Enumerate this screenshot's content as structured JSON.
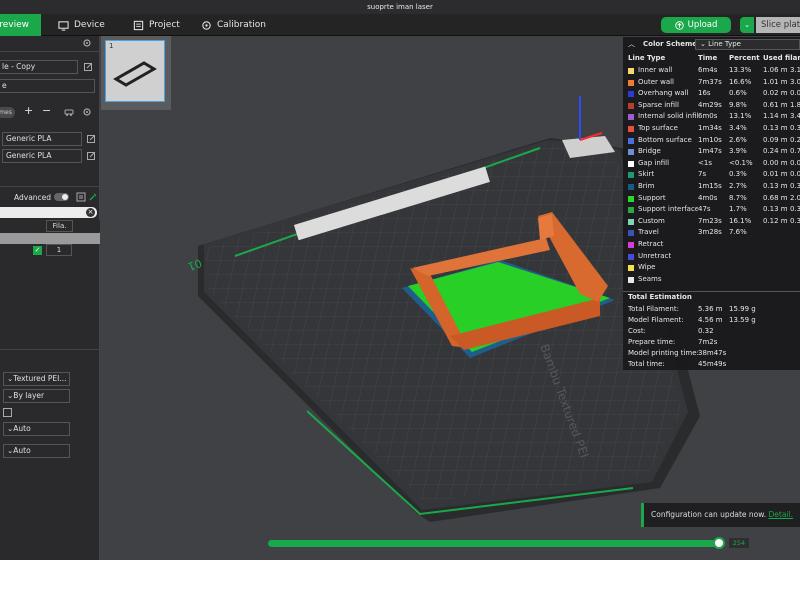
{
  "title": "suoprte iman laser",
  "topbar": {
    "tabs": [
      {
        "label": "review"
      },
      {
        "label": "Device"
      },
      {
        "label": "Project"
      },
      {
        "label": "Calibration"
      }
    ],
    "upload_label": "Upload",
    "slice_label": "Slice plate"
  },
  "sidebar": {
    "profile_value": "le - Copy",
    "profile2_value": "e",
    "items_chip": "mes",
    "filaments": [
      "Generic PLA",
      "Generic PLA"
    ],
    "advanced_label": "Advanced",
    "table_header": "Fila.",
    "table_value": "1",
    "plate_type": "Textured PEI...",
    "layer_mode": "By layer",
    "auto1": "Auto",
    "auto2": "Auto"
  },
  "plate": {
    "number": "1",
    "bed_label": "Bambu Textured PEI",
    "bed_number": "01"
  },
  "legend": {
    "scheme_label": "Color Scheme",
    "scheme_value": "Line Type",
    "headers": [
      "Line Type",
      "Time",
      "Percent",
      "Used filament"
    ],
    "rows": [
      {
        "name": "Inner wall",
        "time": "6m4s",
        "percent": "13.3%",
        "len": "1.06 m",
        "g": "3.1",
        "color": "#f5d76e"
      },
      {
        "name": "Outer wall",
        "time": "7m37s",
        "percent": "16.6%",
        "len": "1.01 m",
        "g": "3.0",
        "color": "#f07c2e"
      },
      {
        "name": "Overhang wall",
        "time": "16s",
        "percent": "0.6%",
        "len": "0.02 m",
        "g": "0.0",
        "color": "#2a3bd8"
      },
      {
        "name": "Sparse infill",
        "time": "4m29s",
        "percent": "9.8%",
        "len": "0.61 m",
        "g": "1.8",
        "color": "#b83d2b"
      },
      {
        "name": "Internal solid infill",
        "time": "6m0s",
        "percent": "13.1%",
        "len": "1.14 m",
        "g": "3.4",
        "color": "#9b5dd0"
      },
      {
        "name": "Top surface",
        "time": "1m34s",
        "percent": "3.4%",
        "len": "0.13 m",
        "g": "0.3",
        "color": "#e84f3c"
      },
      {
        "name": "Bottom surface",
        "time": "1m10s",
        "percent": "2.6%",
        "len": "0.09 m",
        "g": "0.2",
        "color": "#4a6fe0"
      },
      {
        "name": "Bridge",
        "time": "1m47s",
        "percent": "3.9%",
        "len": "0.24 m",
        "g": "0.7",
        "color": "#6d8fd6"
      },
      {
        "name": "Gap infill",
        "time": "<1s",
        "percent": "<0.1%",
        "len": "0.00 m",
        "g": "0.0",
        "color": "#ffffff"
      },
      {
        "name": "Skirt",
        "time": "7s",
        "percent": "0.3%",
        "len": "0.01 m",
        "g": "0.0",
        "color": "#1f9a6e"
      },
      {
        "name": "Brim",
        "time": "1m15s",
        "percent": "2.7%",
        "len": "0.13 m",
        "g": "0.3",
        "color": "#165a8a"
      },
      {
        "name": "Support",
        "time": "4m0s",
        "percent": "8.7%",
        "len": "0.68 m",
        "g": "2.0",
        "color": "#2fd42f"
      },
      {
        "name": "Support interface",
        "time": "47s",
        "percent": "1.7%",
        "len": "0.13 m",
        "g": "0.3",
        "color": "#2aa843"
      },
      {
        "name": "Custom",
        "time": "7m23s",
        "percent": "16.1%",
        "len": "0.12 m",
        "g": "0.3",
        "color": "#7fd6b6"
      },
      {
        "name": "Travel",
        "time": "3m28s",
        "percent": "7.6%",
        "len": "",
        "g": "",
        "color": "#3a52b8"
      },
      {
        "name": "Retract",
        "time": "",
        "percent": "",
        "len": "",
        "g": "",
        "color": "#d63cd6"
      },
      {
        "name": "Unretract",
        "time": "",
        "percent": "",
        "len": "",
        "g": "",
        "color": "#4a4ad8"
      },
      {
        "name": "Wipe",
        "time": "",
        "percent": "",
        "len": "",
        "g": "",
        "color": "#f5e04a"
      },
      {
        "name": "Seams",
        "time": "",
        "percent": "",
        "len": "",
        "g": "",
        "color": "#e8e8e8"
      }
    ],
    "total_label": "Total Estimation",
    "totals": [
      {
        "label": "Total Filament:",
        "v1": "5.36 m",
        "v2": "15.99 g"
      },
      {
        "label": "Model Filament:",
        "v1": "4.56 m",
        "v2": "13.59 g"
      },
      {
        "label": "Cost:",
        "v1": "0.32",
        "v2": ""
      },
      {
        "label": "Prepare time:",
        "v1": "7m2s",
        "v2": ""
      },
      {
        "label": "Model printing time:",
        "v1": "38m47s",
        "v2": ""
      },
      {
        "label": "Total time:",
        "v1": "45m49s",
        "v2": ""
      }
    ]
  },
  "notification": {
    "text": "Configuration can update now.",
    "link": "Detail."
  },
  "slider": {
    "value": "254"
  },
  "colors": {
    "accent": "#1ba84a",
    "background": "#3f4144"
  }
}
